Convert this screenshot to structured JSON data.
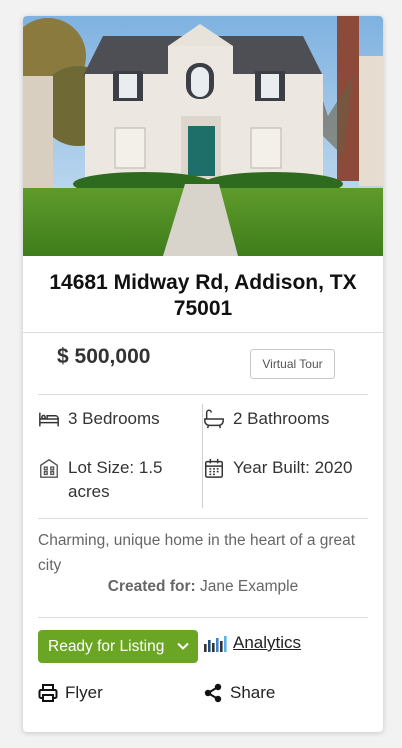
{
  "listing": {
    "address": "14681 Midway Rd, Addison, TX 75001",
    "price": "$ 500,000",
    "virtual_tour_label": "Virtual Tour",
    "features": {
      "bedrooms": "3 Bedrooms",
      "bathrooms": "2 Bathrooms",
      "lot_size": "Lot Size: 1.5 acres",
      "year_built": "Year Built: 2020"
    },
    "description": "Charming, unique home in the heart of a great city",
    "created_for_label": "Created for:",
    "created_for_name": "Jane Example"
  },
  "actions": {
    "status_label": "Ready for Listing",
    "analytics_label": "Analytics",
    "flyer_label": "Flyer",
    "share_label": "Share"
  },
  "icons": {
    "bed": "bed-icon",
    "bath": "bath-icon",
    "lot": "building-icon",
    "year": "calendar-icon",
    "analytics": "bar-chart-icon",
    "flyer": "printer-icon",
    "share": "share-icon",
    "dropdown": "chevron-down-icon"
  },
  "colors": {
    "status_green": "#6aa624",
    "text_dark": "#333333",
    "text_muted": "#666666"
  }
}
